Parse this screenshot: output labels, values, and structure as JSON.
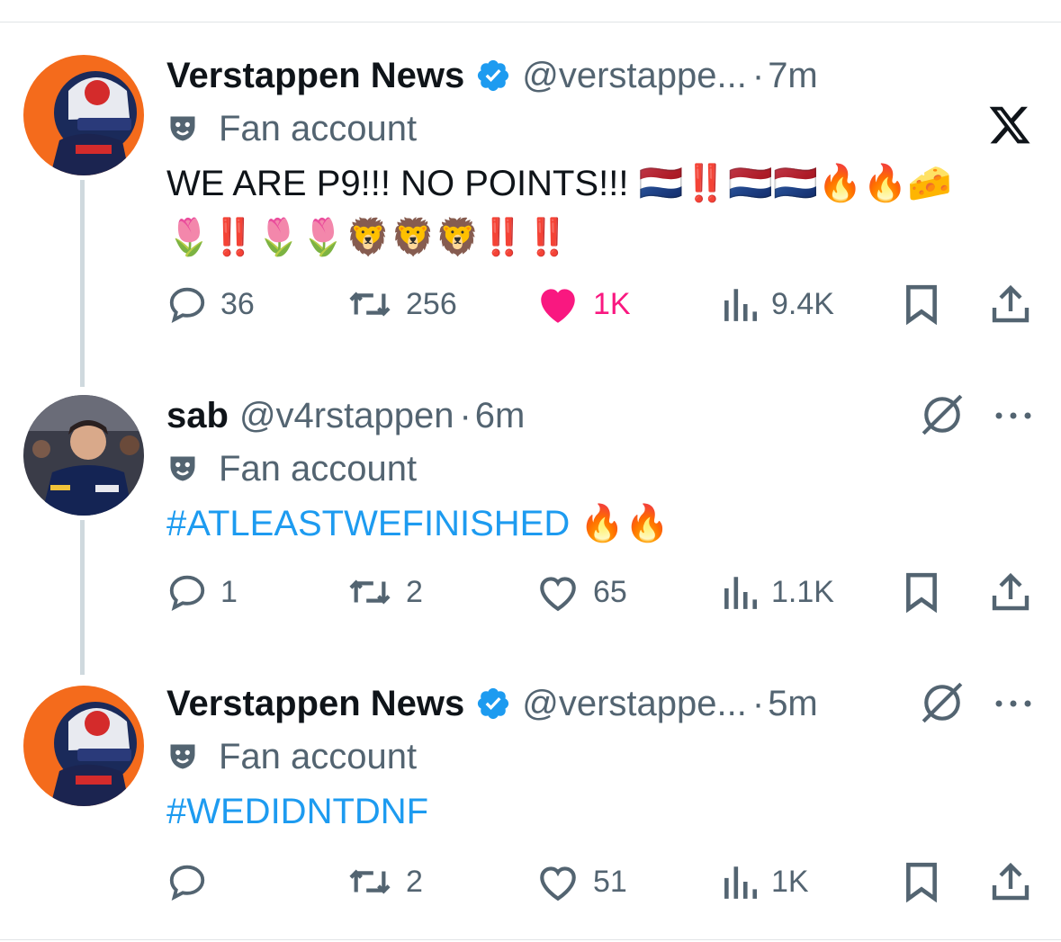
{
  "tweets": [
    {
      "name": "Verstappen News",
      "verified": true,
      "handle": "@verstappe...",
      "time": "7m",
      "fan_label": "Fan account",
      "text": "WE ARE P9!!! NO POINTS!!! 🇳🇱‼️🇳🇱🇳🇱🔥🔥🧀🌷‼️🌷🌷🦁🦁🦁‼️‼️",
      "replies": "36",
      "reposts": "256",
      "likes": "1K",
      "liked": true,
      "views": "9.4K",
      "corner_icon": "x-logo-icon"
    },
    {
      "name": "sab",
      "verified": false,
      "handle": "@v4rstappen",
      "time": "6m",
      "fan_label": "Fan account",
      "text": "#ATLEASTWEFINISHED 🔥🔥",
      "replies": "1",
      "reposts": "2",
      "likes": "65",
      "liked": false,
      "views": "1.1K",
      "corner_icon": "grok-icon"
    },
    {
      "name": "Verstappen News",
      "verified": true,
      "handle": "@verstappe...",
      "time": "5m",
      "fan_label": "Fan account",
      "text": "#WEDIDNTDNF",
      "replies": "",
      "reposts": "2",
      "likes": "51",
      "liked": false,
      "views": "1K",
      "corner_icon": "grok-icon"
    }
  ],
  "colors": {
    "accent": "#1d9bf0",
    "like": "#f91880",
    "muted": "#536471",
    "avatar_orange": "#f46b1c"
  }
}
